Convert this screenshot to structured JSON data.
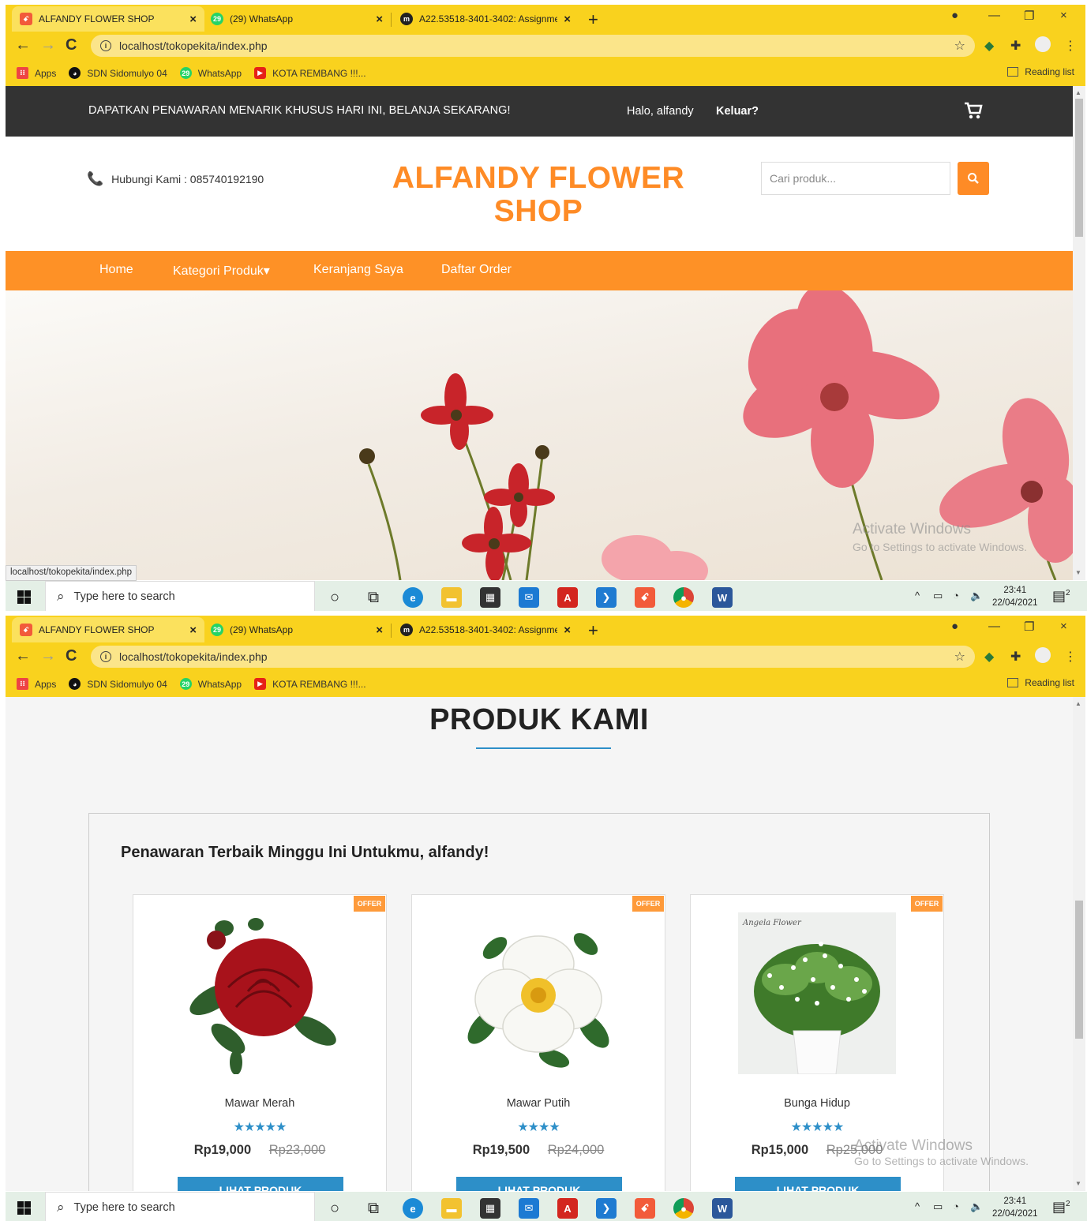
{
  "browser": {
    "tabs": [
      {
        "title": "ALFANDY FLOWER SHOP",
        "active": true
      },
      {
        "title": "(29) WhatsApp",
        "active": false
      },
      {
        "title": "A22.53518-3401-3402: Assignme",
        "active": false
      }
    ],
    "whatsapp_badge": "29",
    "close_glyph": "×",
    "new_tab_glyph": "+",
    "url": "localhost/tokopekita/index.php",
    "bookmarks": [
      {
        "label": "Apps"
      },
      {
        "label": "SDN Sidomulyo 04"
      },
      {
        "label": "WhatsApp"
      },
      {
        "label": "KOTA REMBANG !!!..."
      }
    ],
    "reading_list": "Reading list",
    "status_url": "localhost/tokopekita/index.php",
    "accent_color": "#f9d21e"
  },
  "site": {
    "promo_text": "DAPATKAN PENAWARAN MENARIK KHUSUS HARI INI, BELANJA SEKARANG!",
    "greeting": "Halo, alfandy",
    "logout": "Keluar?",
    "contact": "Hubungi Kami : 085740192190",
    "brand_line1": "ALFANDY FLOWER",
    "brand_line2": "SHOP",
    "search_placeholder": "Cari produk...",
    "nav": [
      "Home",
      "Kategori Produk",
      "Keranjang Saya",
      "Daftar Order"
    ],
    "nav_caret": "▾",
    "accent_color": "#fe8b26",
    "dark_bar_color": "#333333"
  },
  "products": {
    "section_title": "PRODUK KAMI",
    "offer_heading": "Penawaran Terbaik Minggu Ini Untukmu, alfandy!",
    "offer_tag": "OFFER",
    "items": [
      {
        "name": "Mawar Merah",
        "stars": 5,
        "star_text": "★★★★★",
        "price": "Rp19,000",
        "old_price": "Rp23,000",
        "button": "LIHAT PRODUK"
      },
      {
        "name": "Mawar Putih",
        "stars": 4,
        "star_text": "★★★★",
        "price": "Rp19,500",
        "old_price": "Rp24,000",
        "button": "LIHAT PRODUK"
      },
      {
        "name": "Bunga Hidup",
        "stars": 5,
        "star_text": "★★★★★",
        "price": "Rp15,000",
        "old_price": "Rp25,000",
        "button": "LIHAT PRODUK"
      }
    ],
    "image_caption": "Angela Flower",
    "button_color": "#2d8fc8"
  },
  "windows": {
    "watermark_title": "Activate Windows",
    "watermark_sub": "Go to Settings to activate Windows.",
    "search_placeholder": "Type here to search",
    "time": "23:41",
    "date": "22/04/2021",
    "notifications": "2"
  }
}
